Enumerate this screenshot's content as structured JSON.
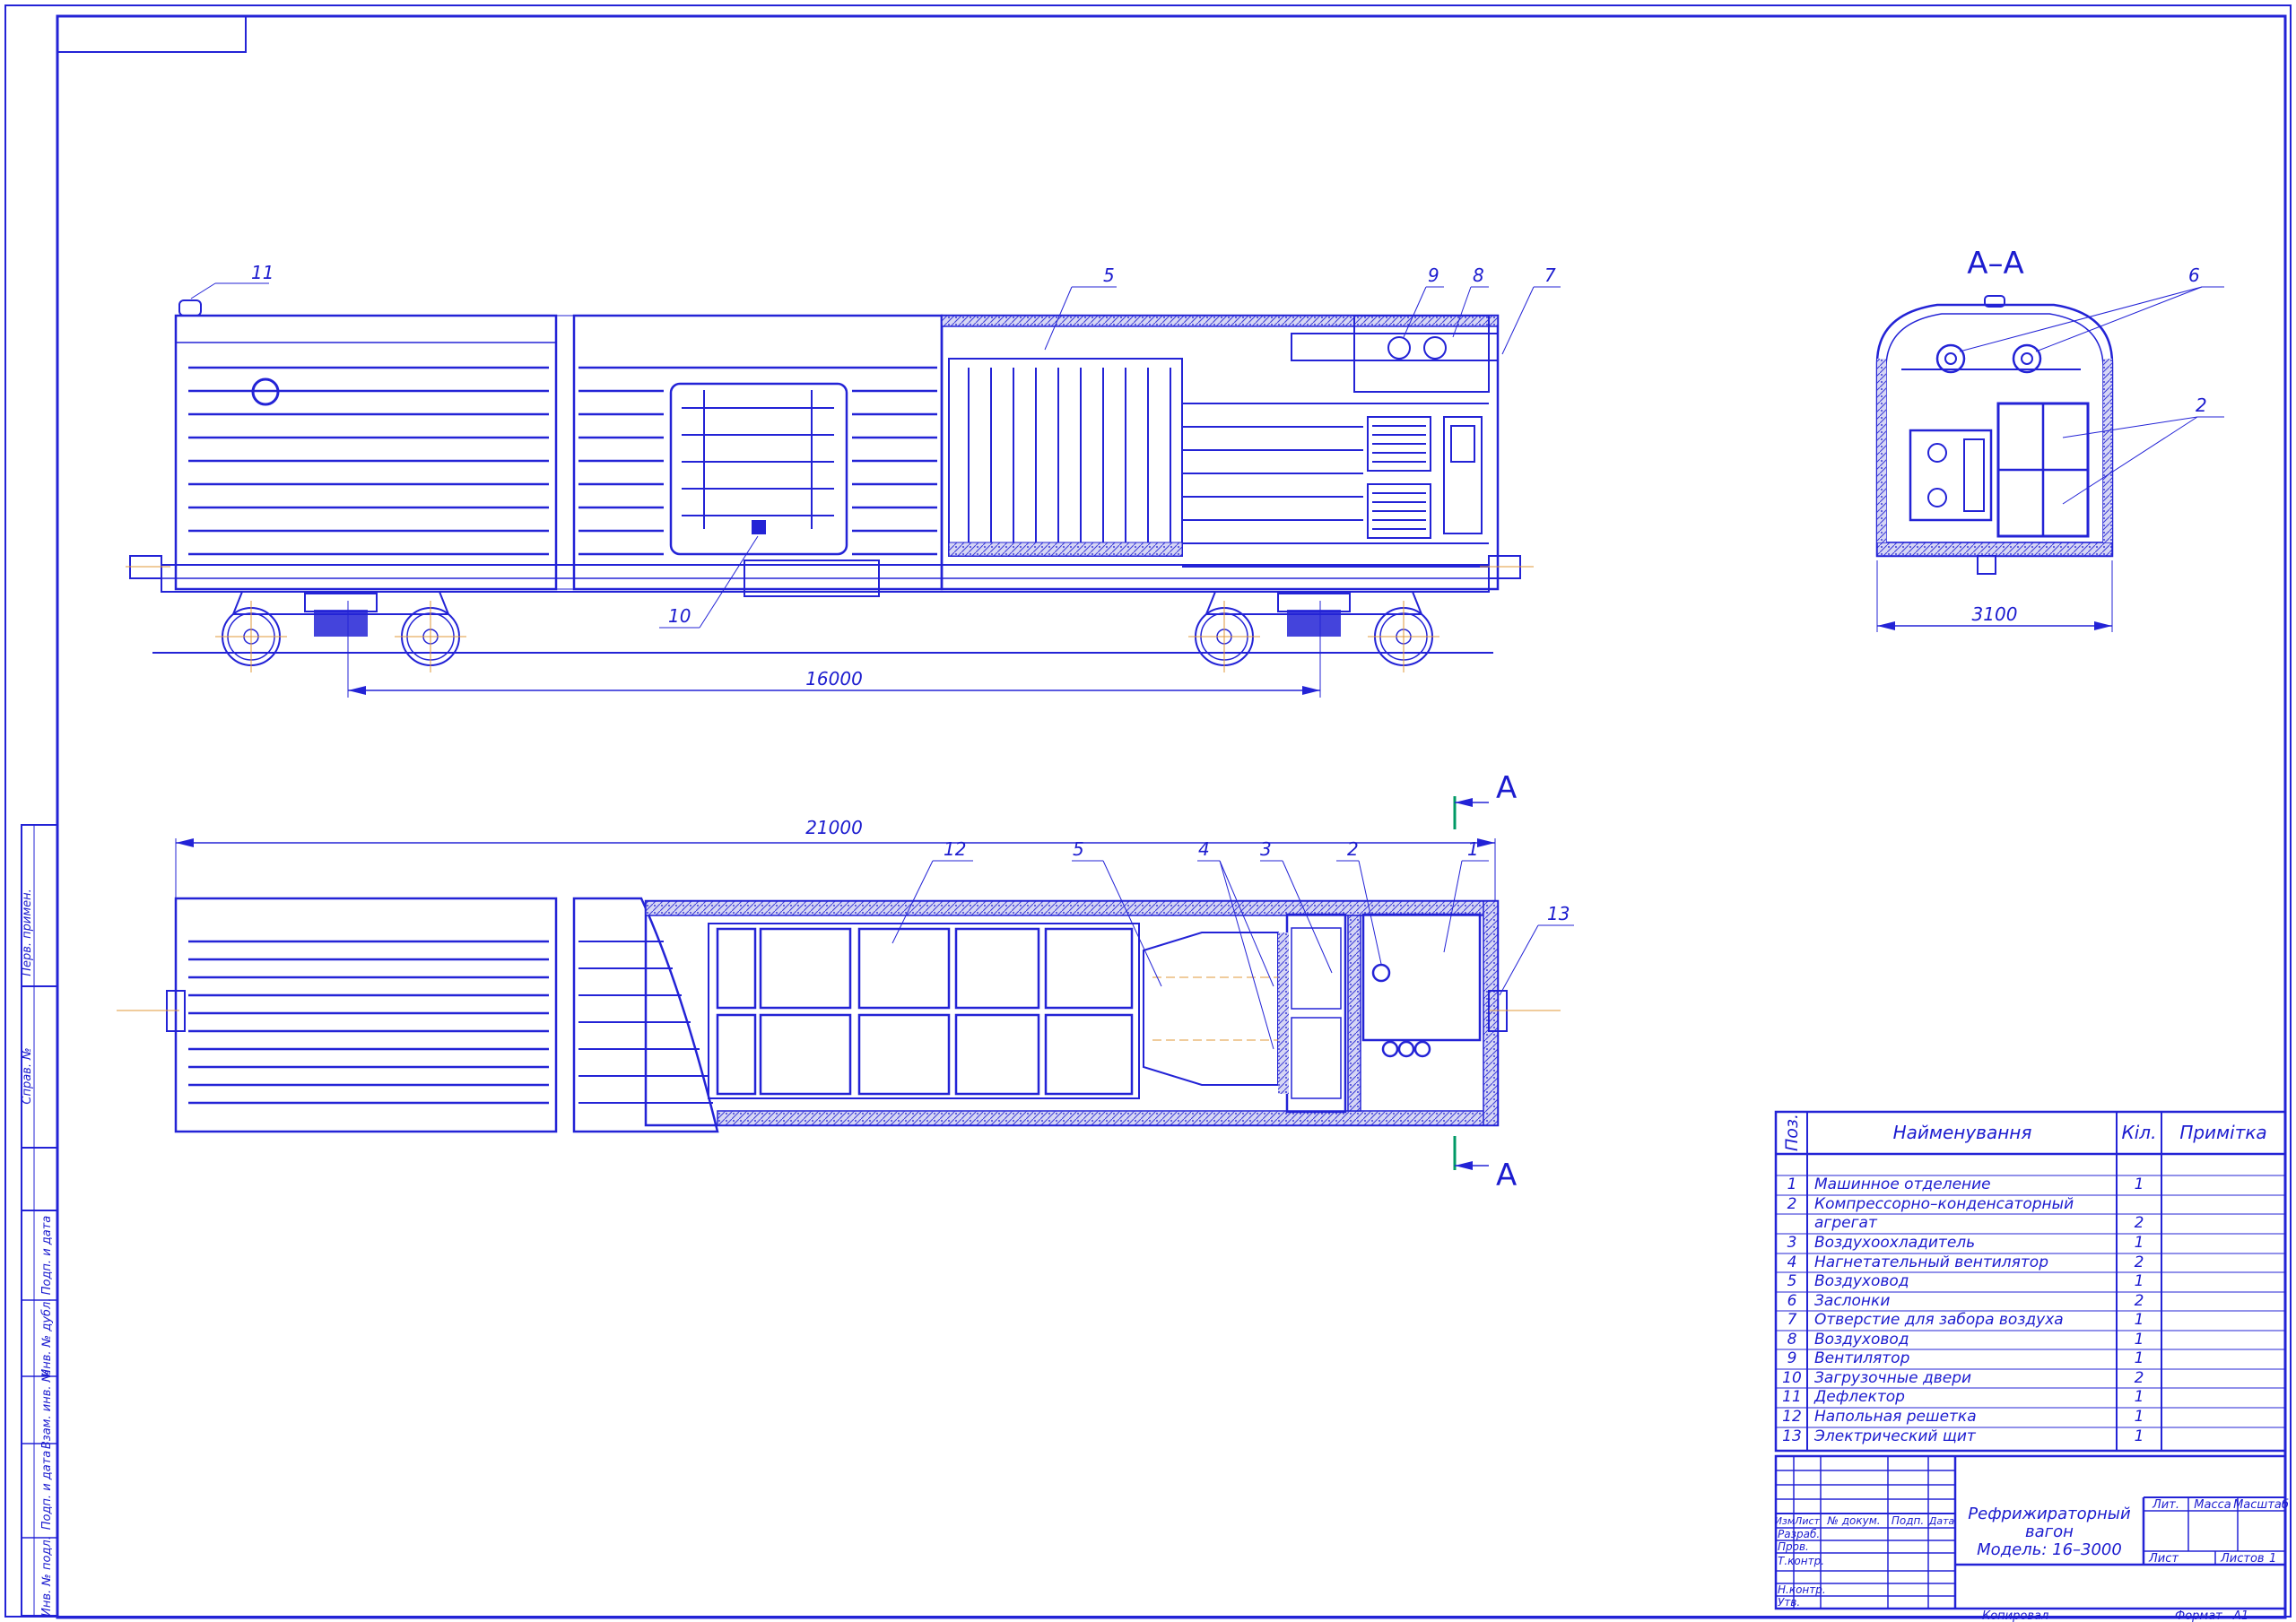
{
  "callouts": {
    "c1": "1",
    "c2": "2",
    "c3": "3",
    "c4": "4",
    "c5": "5",
    "c6": "6",
    "c7": "7",
    "c8": "8",
    "c9": "9",
    "c10": "10",
    "c11": "11",
    "c12": "12",
    "c13": "13"
  },
  "dimensions": {
    "wheelbase": "16000",
    "length": "21000",
    "width": "3100"
  },
  "section": {
    "title": "А–А",
    "marker": "А"
  },
  "side_stamps": [
    "Перв. примен.",
    "Справ. №",
    "Подп. и дата",
    "Инв. № дубл.",
    "Взам. инв. №",
    "Подп. и дата",
    "Инв. № подл."
  ],
  "spec": {
    "headers": {
      "pos": "Поз.",
      "name": "Найменування",
      "qty": "Кіл.",
      "note": "Примітка"
    },
    "rows": [
      {
        "pos": "1",
        "name": "Машинное отделение",
        "qty": "1"
      },
      {
        "pos": "2",
        "name": "Компрессорно–конденсаторный",
        "qty": ""
      },
      {
        "pos": "",
        "name": "агрегат",
        "qty": "2"
      },
      {
        "pos": "3",
        "name": "Воздухоохладитель",
        "qty": "1"
      },
      {
        "pos": "4",
        "name": "Нагнетательный вентилятор",
        "qty": "2"
      },
      {
        "pos": "5",
        "name": "Воздуховод",
        "qty": "1"
      },
      {
        "pos": "6",
        "name": "Заслонки",
        "qty": "2"
      },
      {
        "pos": "7",
        "name": "Отверстие для забора воздуха",
        "qty": "1"
      },
      {
        "pos": "8",
        "name": "Воздуховод",
        "qty": "1"
      },
      {
        "pos": "9",
        "name": "Вентилятор",
        "qty": "1"
      },
      {
        "pos": "10",
        "name": "Загрузочные двери",
        "qty": "2"
      },
      {
        "pos": "11",
        "name": "Дефлектор",
        "qty": "1"
      },
      {
        "pos": "12",
        "name": "Напольная решетка",
        "qty": "1"
      },
      {
        "pos": "13",
        "name": "Электрический щит",
        "qty": "1"
      }
    ]
  },
  "title_block": {
    "title_line1": "Рефрижираторный",
    "title_line2": "вагон",
    "title_line3": "Модель: 16–3000",
    "col_izm": "Изм",
    "col_list": "Лист",
    "col_doc": "№ докум.",
    "col_sign": "Подп.",
    "col_date": "Дата",
    "razrab": "Разраб.",
    "prov": "Пров.",
    "tkontr": "Т.контр.",
    "nkontr": "Н.контр.",
    "utv": "Утв.",
    "lit": "Лит.",
    "massa": "Масса",
    "masshtab": "Масштаб",
    "list": "Лист",
    "listov": "Листов",
    "listov_val": "1",
    "copied": "Копировал",
    "format": "Формат",
    "format_val": "А1"
  },
  "colors": {
    "line": "#2323d6",
    "text": "#1c1ccf",
    "insulation": "#c8c8ee",
    "section_marker": "#009966"
  }
}
